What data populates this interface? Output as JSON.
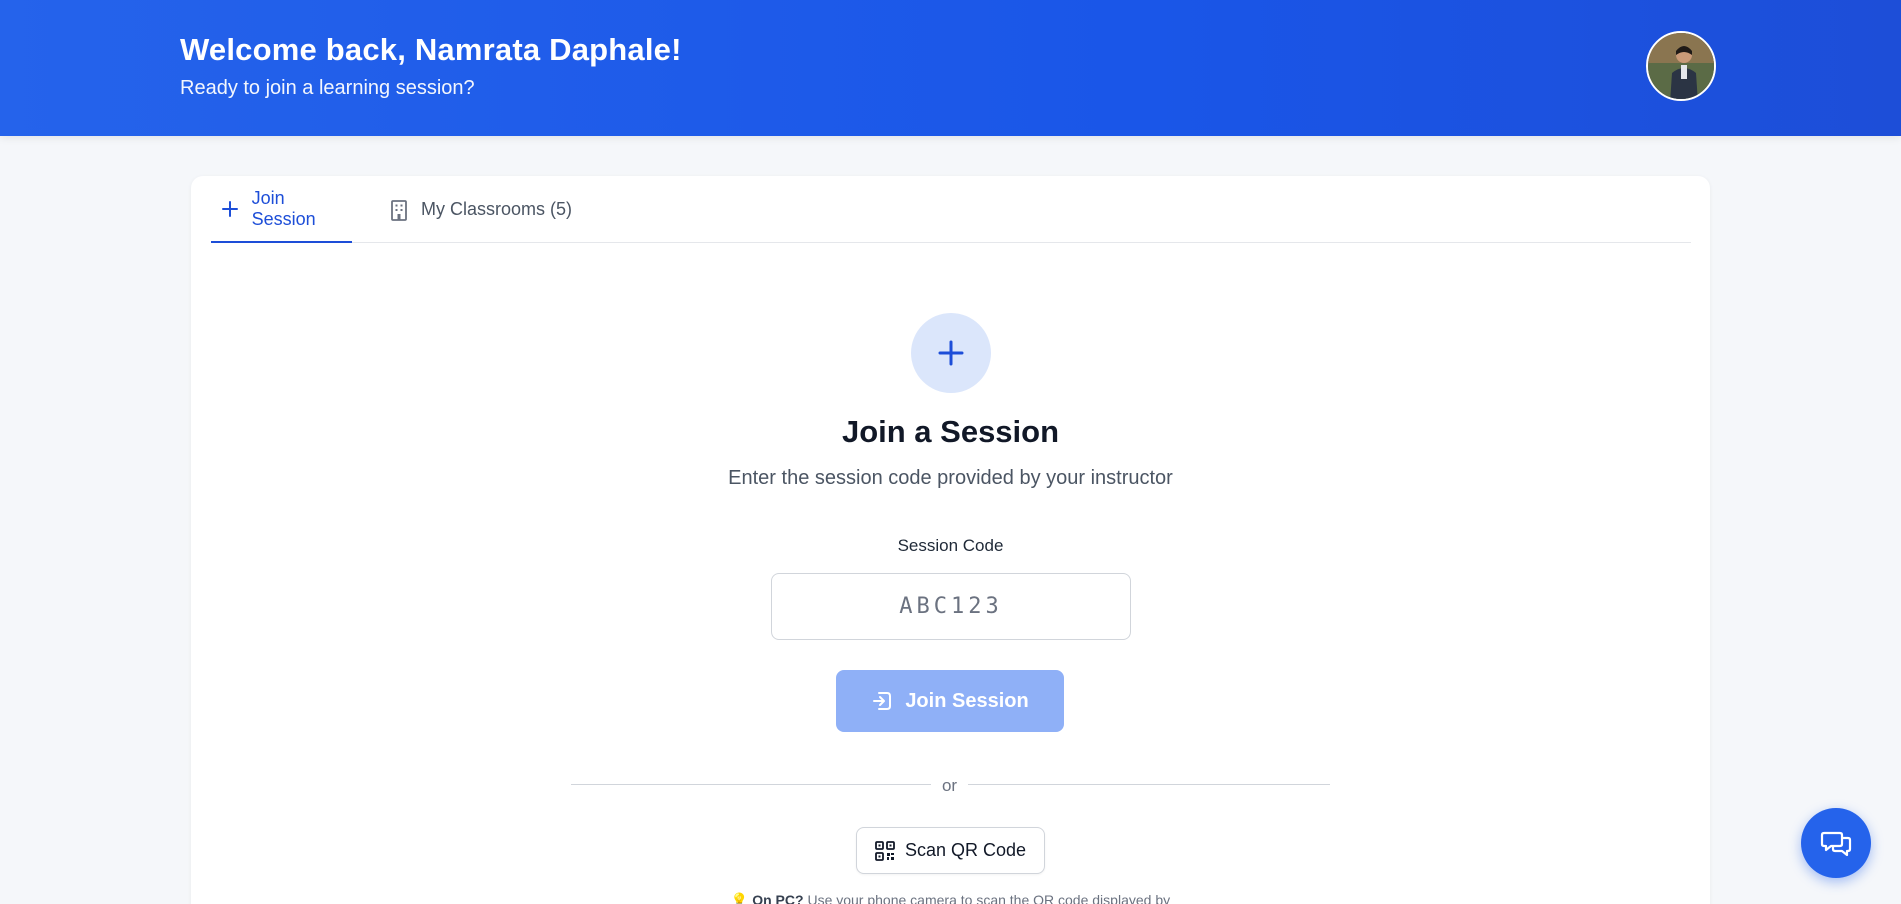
{
  "header": {
    "title": "Welcome back, Namrata Daphale!",
    "subtitle": "Ready to join a learning session?",
    "avatar_icon": "user-avatar"
  },
  "tabs": [
    {
      "label": "Join Session",
      "icon": "plus-icon",
      "active": true
    },
    {
      "label": "My Classrooms (5)",
      "icon": "building-icon",
      "active": false
    }
  ],
  "join": {
    "icon": "plus-icon",
    "title": "Join a Session",
    "subtitle": "Enter the session code provided by your instructor",
    "code_label": "Session Code",
    "code_placeholder": "ABC123",
    "code_value": "",
    "join_button": "Join Session",
    "join_icon": "login-icon",
    "divider_text": "or",
    "qr_button": "Scan QR Code",
    "qr_icon": "qr-code-icon",
    "hint_emoji": "💡",
    "hint_bold": "On PC?",
    "hint_text": "Use your phone camera to scan the QR code displayed by"
  },
  "chat": {
    "icon": "chat-icon"
  },
  "colors": {
    "brand": "#2563eb",
    "join_button_disabled": "#8fb0f7",
    "plus_circle_bg": "#dbe6fb"
  }
}
